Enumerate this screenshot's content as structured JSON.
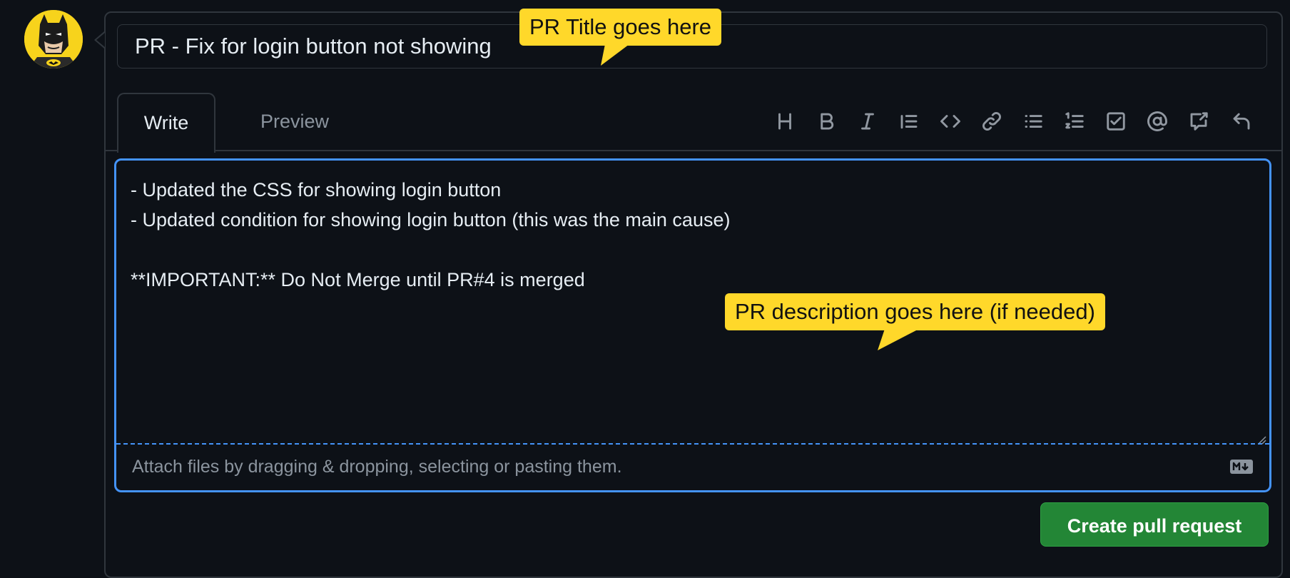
{
  "pr": {
    "title_value": "PR - Fix for login button not showing",
    "tabs": [
      {
        "label": "Write",
        "active": true
      },
      {
        "label": "Preview",
        "active": false
      }
    ],
    "toolbar_icons": [
      "heading-icon",
      "bold-icon",
      "italic-icon",
      "quote-icon",
      "code-icon",
      "link-icon",
      "bulleted-list-icon",
      "numbered-list-icon",
      "task-list-icon",
      "mention-icon",
      "reference-icon",
      "undo-icon"
    ],
    "body_lines": [
      "- Updated the CSS for showing login button",
      "- Updated condition for showing login button (this was the main cause)",
      "",
      "**IMPORTANT:** Do Not Merge until PR#4 is merged"
    ],
    "attach_text": "Attach files by dragging & dropping, selecting or pasting them.",
    "submit_label": "Create pull request"
  },
  "annotations": {
    "title_callout": "PR Title goes here",
    "description_callout": "PR description goes here (if needed)"
  },
  "colors": {
    "background": "#0d1117",
    "border": "#30363d",
    "focus": "#4493f8",
    "primary_button": "#238636",
    "callout": "#ffd82a"
  }
}
